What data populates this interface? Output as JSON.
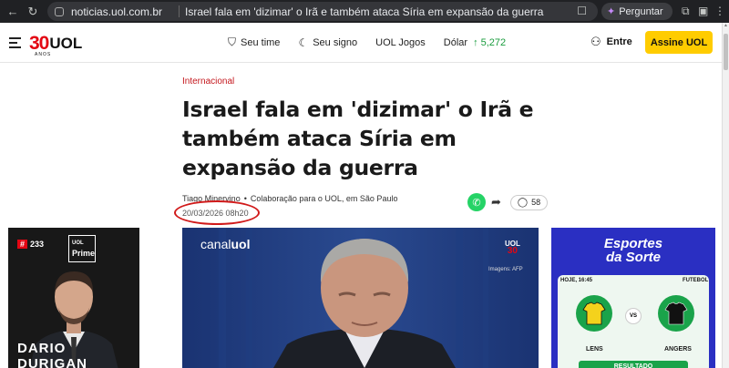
{
  "browser": {
    "url": "noticias.uol.com.br",
    "page_title": "Israel fala em 'dizimar' o Irã e também ataca Síria em expansão da guerra",
    "ask_label": "Perguntar"
  },
  "header": {
    "logo_number": "30",
    "logo_brand": "UOL",
    "logo_sub": "ANOS",
    "nav": [
      {
        "label": "Seu time",
        "icon": "shield-icon"
      },
      {
        "label": "Seu signo",
        "icon": "moon-icon"
      },
      {
        "label": "UOL Jogos"
      }
    ],
    "dolar_label": "Dólar",
    "dolar_value": "↑ 5,272",
    "login_label": "Entre",
    "subscribe_label": "Assine UOL"
  },
  "article": {
    "category": "Internacional",
    "title": "Israel fala em 'dizimar' o Irã e também ataca Síria em expansão da guerra",
    "author": "Tiago Minervino",
    "collab": "Colaboração para o UOL, em São Paulo",
    "date": "20/03/2026 08h20",
    "comments": "58"
  },
  "ad_left": {
    "rank": "233",
    "brand_top": "UOL",
    "brand": "Prime",
    "caption": "DARIO DURIGAN"
  },
  "video": {
    "channel_prefix": "canal",
    "channel_brand": "uol",
    "badge_top": "UOL",
    "badge_number": "30",
    "credit": "Imagens: AFP"
  },
  "ad_right": {
    "brand_line1": "Esportes",
    "brand_line2": "da Sorte",
    "time_label": "HOJE, 16:45",
    "sport": "FUTEBOL",
    "vs": "VS",
    "team_home": "LENS",
    "team_away": "ANGERS",
    "cta": "RESULTADO"
  },
  "colors": {
    "brand_red": "#e30613",
    "accent_yellow": "#ffcc00",
    "dolar_green": "#1a9c3e",
    "highlight_circle": "#d11a1a"
  }
}
